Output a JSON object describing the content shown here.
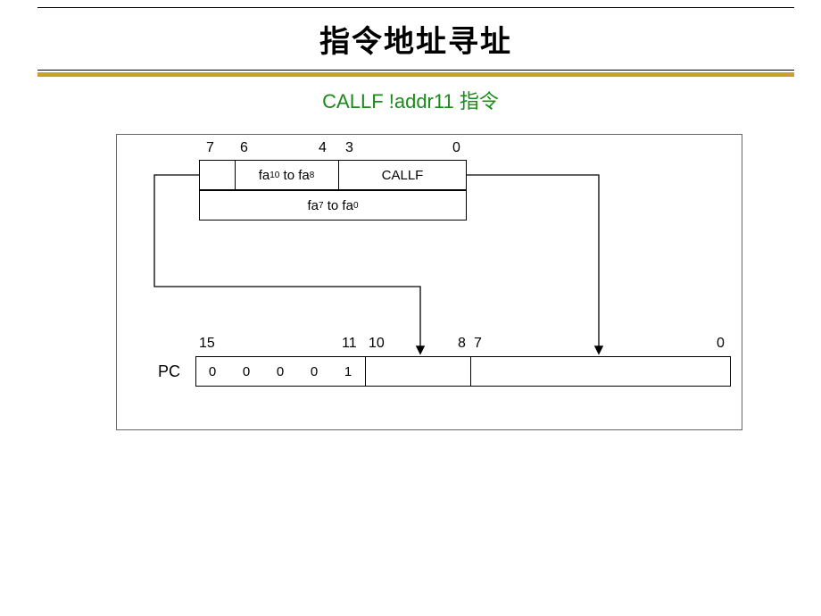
{
  "header": {
    "title": "指令地址寻址"
  },
  "subtitle": "CALLF !addr11 指令",
  "top_word": {
    "ticks": {
      "t7": "7",
      "t6": "6",
      "t4": "4",
      "t3": "3",
      "t0": "0"
    },
    "cell_hi": "fa₁₀ to fa₈",
    "cell_lo": "CALLF",
    "row2": "fa₇ to fa₀"
  },
  "pc_label": "PC",
  "pc_ticks": {
    "t15": "15",
    "t11": "11",
    "t10": "10",
    "t8": "8",
    "t7": "7",
    "t0": "0"
  },
  "pc_bits": [
    "0",
    "0",
    "0",
    "0",
    "1"
  ]
}
